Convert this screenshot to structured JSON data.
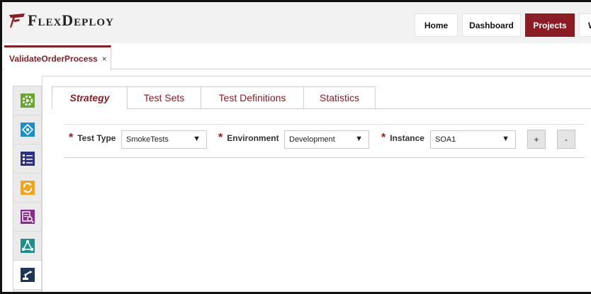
{
  "app": {
    "logo_text": "FlexDeploy"
  },
  "nav": [
    {
      "label": "Home"
    },
    {
      "label": "Dashboard"
    },
    {
      "label": "Projects"
    },
    {
      "label": "W"
    }
  ],
  "doc_tab": {
    "label": "ValidateOrderProcess",
    "close": "×"
  },
  "rail": {
    "items": [
      {
        "icon": "build-gear-icon",
        "color": "#6aa52e"
      },
      {
        "icon": "deploy-diamond-icon",
        "color": "#1a8fc9"
      },
      {
        "icon": "checklist-icon",
        "color": "#2e2f86"
      },
      {
        "icon": "refresh-cycle-icon",
        "color": "#f2a51a"
      },
      {
        "icon": "report-search-icon",
        "color": "#8b2a8e"
      },
      {
        "icon": "workflow-triangle-icon",
        "color": "#1f8f8a"
      },
      {
        "icon": "robot-arm-icon",
        "color": "#1d3557"
      }
    ]
  },
  "tabs": [
    {
      "label": "Strategy"
    },
    {
      "label": "Test Sets"
    },
    {
      "label": "Test Definitions"
    },
    {
      "label": "Statistics"
    }
  ],
  "filters": {
    "required_mark": "*",
    "test_type": {
      "label": "Test Type",
      "value": "SmokeTests"
    },
    "environment": {
      "label": "Environment",
      "value": "Development"
    },
    "instance": {
      "label": "Instance",
      "value": "SOA1"
    },
    "add_label": "+",
    "remove_label": "-",
    "dropdown_arrow": "▼"
  },
  "colors": {
    "brand": "#8b1c24"
  }
}
